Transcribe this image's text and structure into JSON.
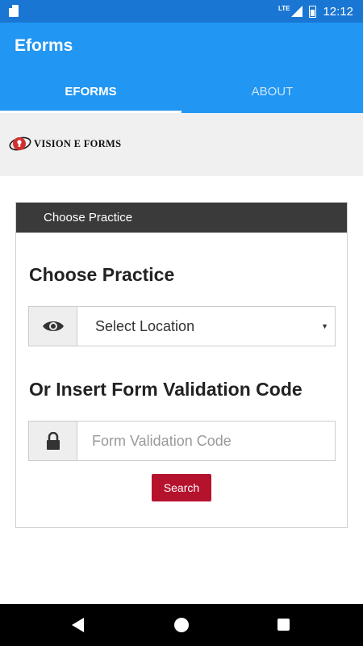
{
  "status_bar": {
    "network": "LTE",
    "time": "12:12"
  },
  "app_bar": {
    "title": "Eforms",
    "tabs": [
      {
        "label": "EFORMS",
        "active": true
      },
      {
        "label": "ABOUT",
        "active": false
      }
    ],
    "color": "#2196f3"
  },
  "logo": {
    "text": "VISION E FORMS",
    "accent_color": "#d32f2f"
  },
  "card": {
    "header": "Choose Practice",
    "heading_practice": "Choose Practice",
    "location_select": {
      "icon": "eye-icon",
      "selected": "Select Location"
    },
    "heading_code": "Or Insert Form Validation Code",
    "code_input": {
      "icon": "lock-icon",
      "value": "",
      "placeholder": "Form Validation Code"
    },
    "search_button": {
      "label": "Search",
      "color": "#b5122d"
    }
  },
  "nav_bar": {
    "icons": [
      "back-icon",
      "home-icon",
      "recent-apps-icon"
    ]
  }
}
